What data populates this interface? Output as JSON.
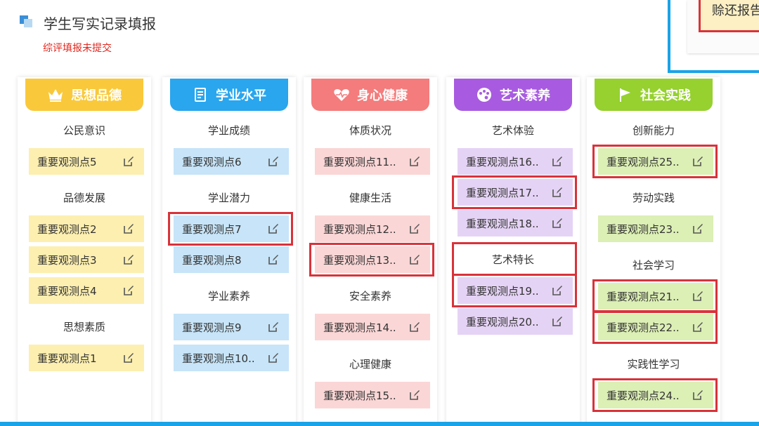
{
  "page": {
    "title": "学生写实记录填报",
    "status": "综评填报未提交",
    "corner_button": "赊还报告"
  },
  "colors": {
    "blue_accent": "#1aa3e8",
    "status_red": "#e0261d",
    "highlight_red": "#d9323a"
  },
  "columns": [
    {
      "title": "思想品德",
      "icon": "crown-icon",
      "header_color": "#f9c93b",
      "item_color": "#fcefb0",
      "groups": [
        {
          "name": "公民意识",
          "items": [
            "重要观测点5"
          ]
        },
        {
          "name": "品德发展",
          "items": [
            "重要观测点2",
            "重要观测点3",
            "重要观测点4"
          ]
        },
        {
          "name": "思想素质",
          "items": [
            "重要观测点1"
          ]
        }
      ]
    },
    {
      "title": "学业水平",
      "icon": "book-icon",
      "header_color": "#29a6ee",
      "item_color": "#c7e4f8",
      "groups": [
        {
          "name": "学业成绩",
          "items": [
            "重要观测点6"
          ]
        },
        {
          "name": "学业潜力",
          "items": [
            "重要观测点7",
            "重要观测点8"
          ]
        },
        {
          "name": "学业素养",
          "items": [
            "重要观测点9",
            "重要观测点10.."
          ]
        }
      ]
    },
    {
      "title": "身心健康",
      "icon": "heartbeat-icon",
      "header_color": "#f47c7c",
      "item_color": "#fbd6d6",
      "groups": [
        {
          "name": "体质状况",
          "items": [
            "重要观测点11.."
          ]
        },
        {
          "name": "健康生活",
          "items": [
            "重要观测点12..",
            "重要观测点13.."
          ]
        },
        {
          "name": "安全素养",
          "items": [
            "重要观测点14.."
          ]
        },
        {
          "name": "心理健康",
          "items": [
            "重要观测点15.."
          ]
        }
      ]
    },
    {
      "title": "艺术素养",
      "icon": "palette-icon",
      "header_color": "#a85be0",
      "item_color": "#e5d3f5",
      "groups": [
        {
          "name": "艺术体验",
          "items": [
            "重要观测点16..",
            "重要观测点17..",
            "重要观测点18.."
          ]
        },
        {
          "name": "艺术特长",
          "items": [
            "重要观测点19..",
            "重要观测点20.."
          ]
        }
      ]
    },
    {
      "title": "社会实践",
      "icon": "flag-icon",
      "header_color": "#96d12f",
      "item_color": "#dcefb5",
      "groups": [
        {
          "name": "创新能力",
          "items": [
            "重要观测点25.."
          ]
        },
        {
          "name": "劳动实践",
          "items": [
            "重要观测点23.."
          ]
        },
        {
          "name": "社会学习",
          "items": [
            "重要观测点21..",
            "重要观测点22.."
          ]
        },
        {
          "name": "实践性学习",
          "items": [
            "重要观测点24.."
          ]
        }
      ]
    }
  ]
}
